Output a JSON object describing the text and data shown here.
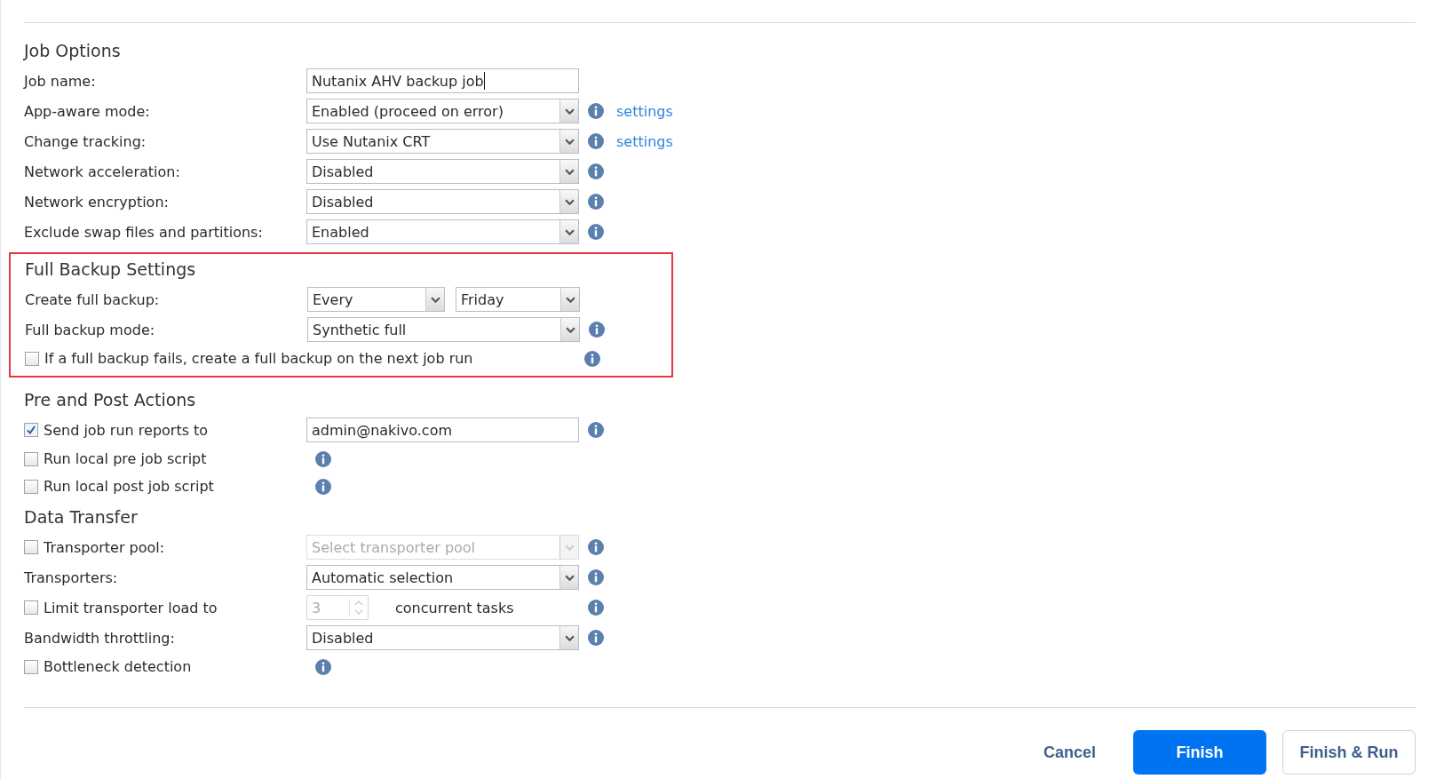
{
  "sections": [
    {
      "title": "Job Options",
      "rows": [
        {
          "kind": "field",
          "label": "Job name:",
          "control": {
            "kind": "text",
            "value": "Nutanix AHV backup job",
            "caret": true
          }
        },
        {
          "kind": "field",
          "label": "App-aware mode:",
          "control": {
            "kind": "select",
            "value": "Enabled (proceed on error)"
          },
          "info": true,
          "link": "settings"
        },
        {
          "kind": "field",
          "label": "Change tracking:",
          "control": {
            "kind": "select",
            "value": "Use Nutanix CRT"
          },
          "info": true,
          "link": "settings"
        },
        {
          "kind": "field",
          "label": "Network acceleration:",
          "control": {
            "kind": "select",
            "value": "Disabled"
          },
          "info": true
        },
        {
          "kind": "field",
          "label": "Network encryption:",
          "control": {
            "kind": "select",
            "value": "Disabled"
          },
          "info": true
        },
        {
          "kind": "field",
          "label": "Exclude swap files and partitions:",
          "control": {
            "kind": "select",
            "value": "Enabled"
          },
          "info": true
        }
      ]
    },
    {
      "title": "Full Backup Settings",
      "highlighted": true,
      "rows": [
        {
          "kind": "field",
          "label": "Create full backup:",
          "control": {
            "kind": "select_pair",
            "values": [
              "Every",
              "Friday"
            ]
          }
        },
        {
          "kind": "field",
          "label": "Full backup mode:",
          "control": {
            "kind": "select",
            "value": "Synthetic full"
          },
          "info": true
        },
        {
          "kind": "check_long",
          "label": "If a full backup fails, create a full backup on the next job run",
          "checked": false,
          "info": true
        }
      ]
    },
    {
      "title": "Pre and Post Actions",
      "rows": [
        {
          "kind": "check",
          "label": "Send job run reports to",
          "checked": true,
          "control": {
            "kind": "text",
            "value": "admin@nakivo.com"
          },
          "info": true
        },
        {
          "kind": "check",
          "label": "Run local pre job script",
          "checked": false,
          "info": true
        },
        {
          "kind": "check",
          "label": "Run local post job script",
          "checked": false,
          "info": true
        }
      ]
    },
    {
      "title": "Data Transfer",
      "rows": [
        {
          "kind": "check",
          "label": "Transporter pool:",
          "checked": false,
          "control": {
            "kind": "select",
            "placeholder": "Select transporter pool",
            "disabled": true
          },
          "info": true
        },
        {
          "kind": "field",
          "label": "Transporters:",
          "control": {
            "kind": "select",
            "value": "Automatic selection"
          },
          "info": true
        },
        {
          "kind": "check",
          "label": "Limit transporter load to",
          "checked": false,
          "control": {
            "kind": "number",
            "value": "3",
            "suffix": "concurrent tasks",
            "disabled": true
          },
          "info": true
        },
        {
          "kind": "field",
          "label": "Bandwidth throttling:",
          "control": {
            "kind": "select",
            "value": "Disabled"
          },
          "info": true
        },
        {
          "kind": "check",
          "label": "Bottleneck detection",
          "checked": false,
          "info": true
        }
      ]
    }
  ],
  "buttons": [
    {
      "label": "Cancel",
      "kind": "link"
    },
    {
      "label": "Finish",
      "kind": "primary"
    },
    {
      "label": "Finish & Run",
      "kind": "secondary"
    }
  ]
}
